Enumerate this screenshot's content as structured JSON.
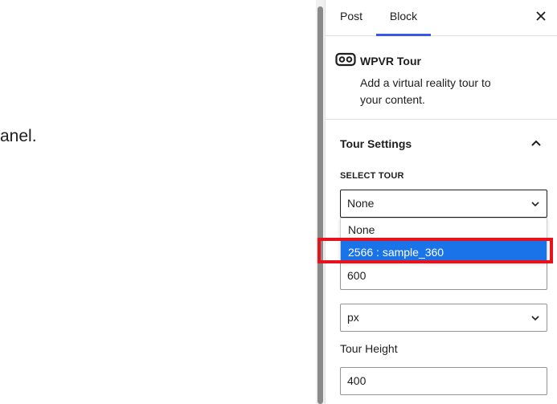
{
  "canvas": {
    "visible_text": "anel."
  },
  "tabs": {
    "post": "Post",
    "block": "Block"
  },
  "block": {
    "title": "WPVR Tour",
    "description": "Add a virtual reality tour to your content.",
    "icon": "vr-headset-icon"
  },
  "panel": {
    "title": "Tour Settings",
    "select_label": "SELECT TOUR",
    "select_value": "None",
    "options": [
      "None",
      "2566 : sample_360"
    ],
    "highlighted_option": "2566 : sample_360",
    "width_value": "600",
    "unit_value": "px",
    "height_label": "Tour Height",
    "height_value": "400"
  },
  "colors": {
    "accent": "#3858e9",
    "option_selected_bg": "#1a73e8",
    "highlight": "#e8121c"
  }
}
